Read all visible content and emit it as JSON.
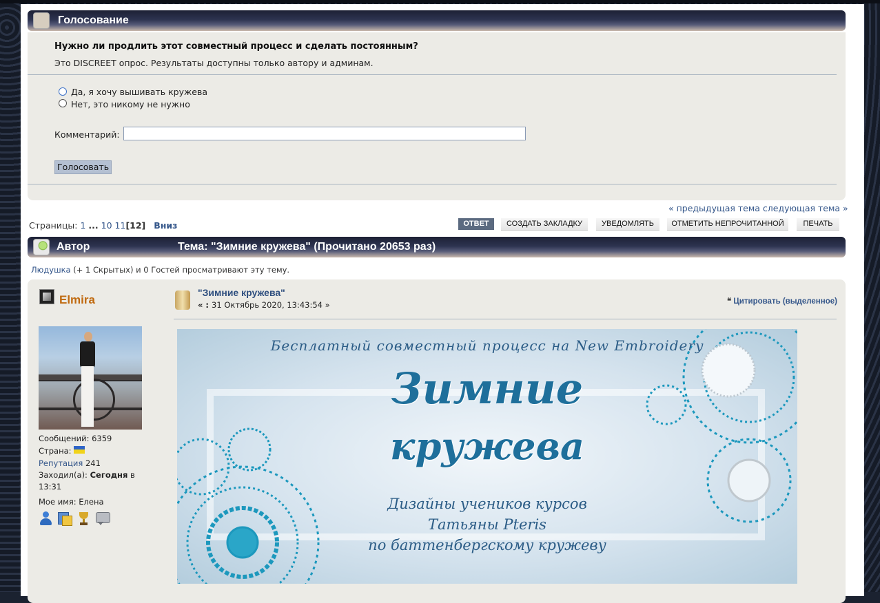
{
  "poll": {
    "header": "Голосование",
    "question": "Нужно ли продлить этот совместный процесс и сделать постоянным?",
    "note": "Это DISCREET опрос. Результаты доступны только автору и админам.",
    "options": [
      "Да, я хочу вышивать кружева",
      "Нет, это никому не нужно"
    ],
    "comment_label": "Комментарий:",
    "comment_value": "",
    "vote_label": "Голосовать"
  },
  "nav": {
    "prev_next": "« предыдущая тема следующая тема »",
    "pages_label": "Страницы:",
    "page1": "1",
    "ellipsis": "...",
    "page10": "10",
    "page11": "11",
    "current_page": "[12]",
    "down_label": "Вниз",
    "buttons": [
      "ОТВЕТ",
      "СОЗДАТЬ ЗАКЛАДКУ",
      "УВЕДОМЛЯТЬ",
      "ОТМЕТИТЬ НЕПРОЧИТАННОЙ",
      "ПЕЧАТЬ"
    ]
  },
  "topic": {
    "author_label": "Автор",
    "title": "Тема: \"Зимние кружева\"  (Прочитано 20653 раз)",
    "viewers_user": "Людушка",
    "viewers_rest": " (+ 1 Скрытых) и 0 Гостей просматривают эту тему."
  },
  "post": {
    "author": "Elmira",
    "messages": "Сообщений: 6359",
    "country_label": "Страна:",
    "reputation_label": "Репутация",
    "reputation_value": "241",
    "last_seen_label": "Заходил(а):",
    "last_seen_value": "Сегодня",
    "last_seen_suffix": "в",
    "last_seen_time": "13:31",
    "my_name": "Мое имя: Елена",
    "subject": "\"Зимние кружева\"",
    "date_prefix": "« : ",
    "date": "31 Октябрь 2020, 13:43:54 »",
    "quote_icon": "❝",
    "quote_label": "Цитировать (выделенное)"
  },
  "banner": {
    "line1": "Бесплатный совместный процесс на New Embroidery",
    "title1": "Зимние",
    "title2": "кружева",
    "sub1": "Дизайны учеников курсов",
    "sub2": "Татьяны Pteris",
    "sub3": "по баттенбергскому кружеву"
  },
  "colors": {
    "accent": "#34568a",
    "author": "#c06a10",
    "panel": "#ecebe6",
    "reply_button": "#5b6a80"
  }
}
